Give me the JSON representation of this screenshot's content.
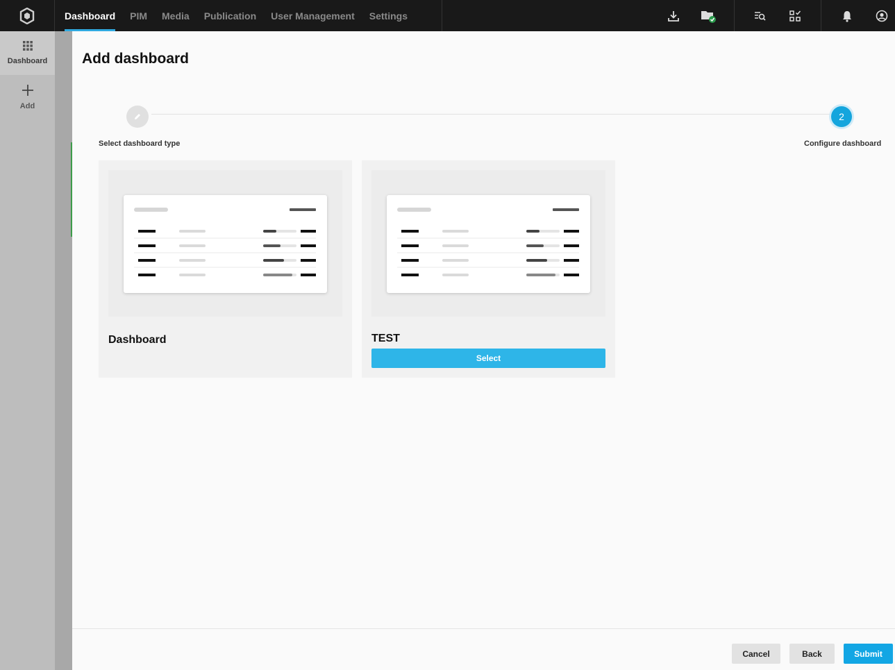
{
  "topbar": {
    "logo_icon": "hexagon-logo-icon",
    "nav": [
      {
        "label": "Dashboard",
        "active": true
      },
      {
        "label": "PIM",
        "active": false
      },
      {
        "label": "Media",
        "active": false
      },
      {
        "label": "Publication",
        "active": false
      },
      {
        "label": "User Management",
        "active": false
      },
      {
        "label": "Settings",
        "active": false
      }
    ],
    "icons": [
      "download-icon",
      "folder-check-icon",
      "search-list-icon",
      "checklist-icon",
      "bell-icon",
      "user-circle-icon"
    ],
    "accent": "#30a9df"
  },
  "sidebar": {
    "items": [
      {
        "label": "Dashboard",
        "icon": "grid-icon"
      },
      {
        "label": "Add",
        "icon": "plus-icon"
      }
    ]
  },
  "modal": {
    "title": "Add dashboard",
    "steps": [
      {
        "label": "Select dashboard type",
        "icon": "pencil-icon",
        "state": "done"
      },
      {
        "label": "Configure dashboard",
        "number": "2",
        "state": "current"
      }
    ],
    "cards": [
      {
        "title": "Dashboard"
      },
      {
        "title": "TEST",
        "button": "Select"
      }
    ],
    "footer": {
      "cancel": "Cancel",
      "back": "Back",
      "submit": "Submit"
    },
    "colors": {
      "primary": "#12a6e4",
      "select": "#2eb5e8"
    }
  }
}
